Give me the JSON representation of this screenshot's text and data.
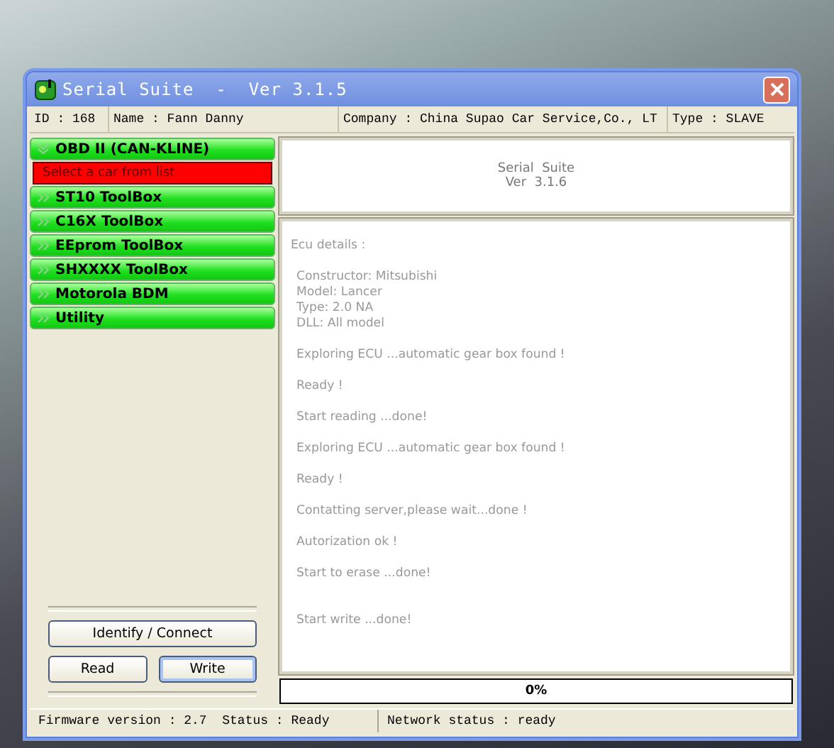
{
  "window": {
    "title": "Serial Suite  -  Ver 3.1.5"
  },
  "info_bar": [
    {
      "text": "ID : 168"
    },
    {
      "text": "Name : Fann Danny"
    },
    {
      "text": "Company : China Supao Car Service,Co., LT"
    },
    {
      "text": "Type : SLAVE"
    }
  ],
  "sidebar": {
    "items": [
      {
        "label": "OBD II (CAN-KLINE)",
        "expanded": true,
        "children": [
          {
            "label": "Select a car from list",
            "selected": true
          }
        ]
      },
      {
        "label": "ST10 ToolBox",
        "expanded": false
      },
      {
        "label": "C16X ToolBox",
        "expanded": false
      },
      {
        "label": "EEprom ToolBox",
        "expanded": false
      },
      {
        "label": "SHXXXX ToolBox",
        "expanded": false
      },
      {
        "label": "Motorola BDM",
        "expanded": false
      },
      {
        "label": "Utility",
        "expanded": false
      }
    ]
  },
  "buttons": [
    {
      "label": "Identify / Connect",
      "focused": false
    },
    {
      "label": "Read",
      "focused": false
    },
    {
      "label": "Write",
      "focused": true
    }
  ],
  "header": {
    "lines": [
      "Serial  Suite",
      "Ver  3.1.6"
    ]
  },
  "log": [
    {
      "lines": [
        "Ecu details :"
      ]
    },
    {
      "lines": [
        "Constructor: Mitsubishi",
        "Model: Lancer",
        "Type: 2.0 NA",
        "DLL: All model"
      ]
    },
    {
      "lines": [
        "Exploring ECU ...automatic gear box found !"
      ]
    },
    {
      "lines": [
        "Ready !"
      ]
    },
    {
      "lines": [
        "Start reading ...done!"
      ]
    },
    {
      "lines": [
        "Exploring ECU ...automatic gear box found !"
      ]
    },
    {
      "lines": [
        "Ready !"
      ]
    },
    {
      "lines": [
        "Contatting server,please wait...done !"
      ]
    },
    {
      "lines": [
        "Autorization ok !"
      ]
    },
    {
      "lines": [
        "Start to erase ...done!"
      ]
    },
    {
      "lines": [
        "Start write ...done!"
      ]
    }
  ],
  "progress": {
    "level": 0,
    "reading": "0%"
  },
  "status_bar": [
    {
      "text": "Firmware version : 2.7  Status : Ready"
    },
    {
      "text": "Network status : ready"
    }
  ]
}
